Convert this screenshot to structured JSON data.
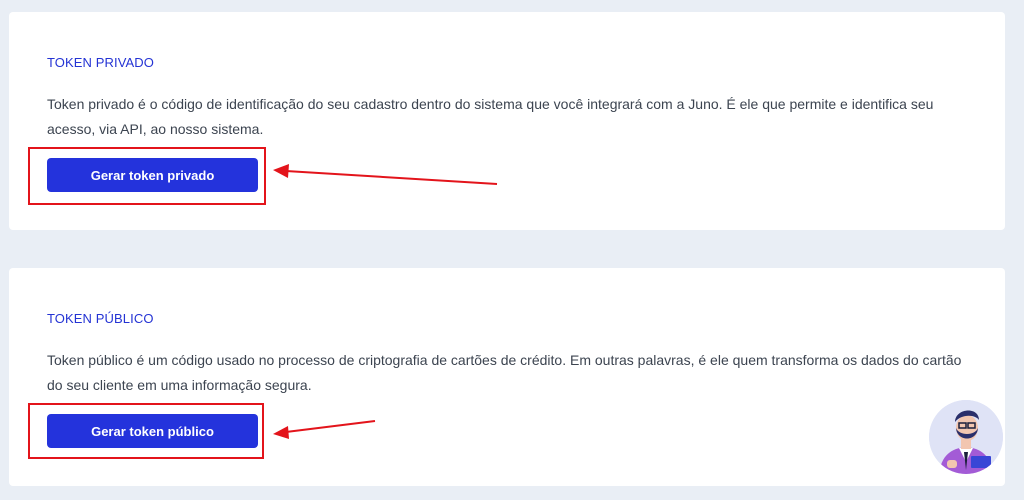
{
  "private_token": {
    "title": "TOKEN PRIVADO",
    "description": "Token privado é o código de identificação do seu cadastro dentro do sistema que você integrará com a Juno. É ele que permite e identifica seu acesso, via API, ao nosso sistema.",
    "button_label": "Gerar token privado"
  },
  "public_token": {
    "title": "TOKEN PÚBLICO",
    "description": "Token público é um código usado no processo de criptografia de cartões de crédito. Em outras palavras, é ele quem transforma os dados do cartão do seu cliente em uma informação segura.",
    "button_label": "Gerar token público"
  },
  "colors": {
    "background": "#e9eef5",
    "card": "#ffffff",
    "title": "#2433d4",
    "button": "#2433dc",
    "annotation": "#e3141b"
  },
  "icons": {
    "assistant": "assistant-avatar-icon",
    "annotation_arrow": "red-arrow-icon"
  }
}
